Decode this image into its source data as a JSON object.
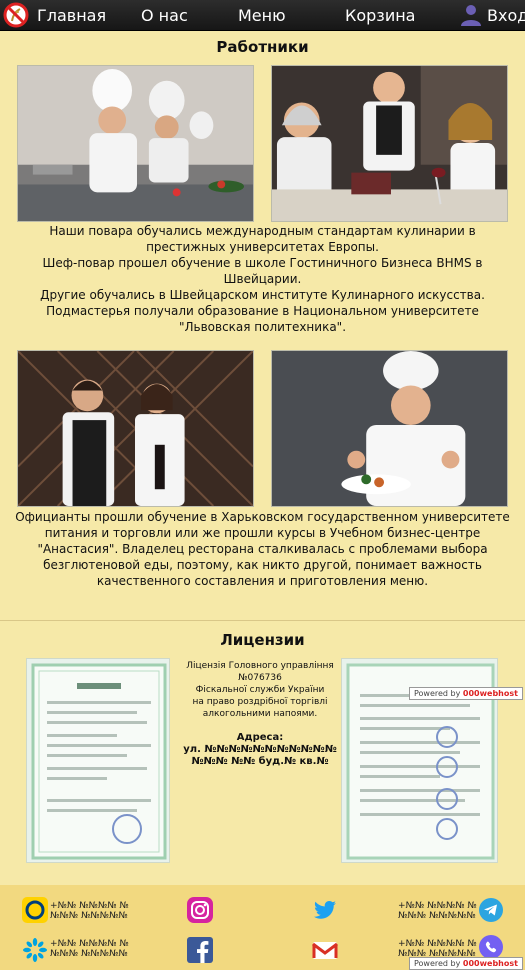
{
  "nav": {
    "home": "Главная",
    "about": "О нас",
    "menu": "Меню",
    "cart": "Корзина",
    "login": "Вход"
  },
  "staff": {
    "title": "Работники",
    "paragraph1": [
      "Наши повара обучались международным стандартам кулинарии в престижных университетах Европы.",
      "Шеф-повар прошел обучение в школе Гостиничного Бизнеса BHMS в Швейцарии.",
      "Другие обучались в Швейцарском институте Кулинарного искусства.",
      "Подмастерья получали образование в Национальном университете \"Львовская политехника\"."
    ],
    "paragraph2": "Официанты прошли обучение в Харьковском государственном университете питания и торговли или же прошли курсы в Учебном бизнес-центре \"Анастасия\". Владелец ресторана сталкивалась с проблемами выбора безглютеновой еды, поэтому, как никто другой, понимает важность качественного составления и приготовления меню."
  },
  "licenses": {
    "title": "Лицензии",
    "text_lines": [
      "Ліцензія Головного управління",
      "№076736",
      "Фіскальної служби України",
      "на право роздрібної торгівлі",
      "алкогольними напоями."
    ],
    "address_label": "Адреса:",
    "address": "ул. №№№№№№№№№№№№№№ №№ буд.№ кв.№"
  },
  "badge": {
    "prefix": "Powered by",
    "brand": "000webhost"
  },
  "footer": {
    "contact1": "+№№ №№№№ №\n№№№ №№№№№",
    "contact2": "+№№ №№№№ №\n№№№ №№№№№",
    "contact3": "+№№ №№№№ №\n№№№ №№№№№",
    "contact4": "+№№ №№№№ №\n№№№ №№№№№"
  },
  "colors": {
    "background": "#f6e9a8",
    "nav": "#1e1e1e",
    "footer": "#f2d980",
    "twitter": "#1da1f2",
    "telegram": "#2ca5e0",
    "facebook": "#3b5998",
    "viber": "#7360f2"
  }
}
